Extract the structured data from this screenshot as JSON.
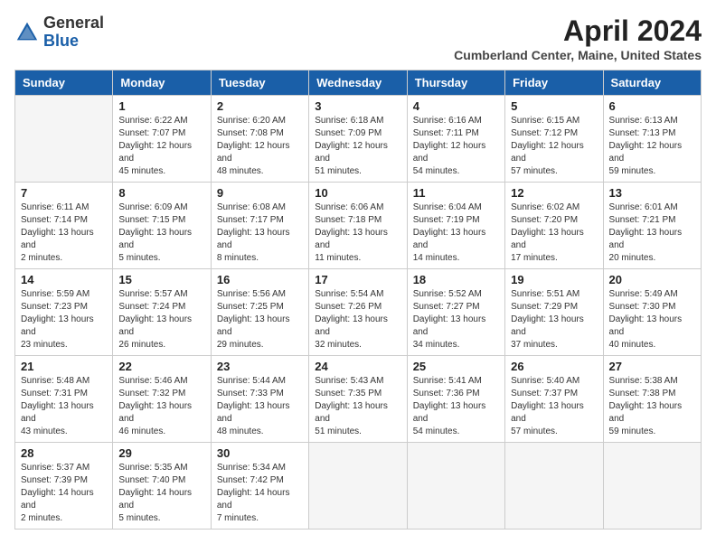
{
  "logo": {
    "general": "General",
    "blue": "Blue"
  },
  "header": {
    "month_year": "April 2024",
    "location": "Cumberland Center, Maine, United States"
  },
  "days_of_week": [
    "Sunday",
    "Monday",
    "Tuesday",
    "Wednesday",
    "Thursday",
    "Friday",
    "Saturday"
  ],
  "weeks": [
    [
      {
        "day": "",
        "empty": true
      },
      {
        "day": "1",
        "sunrise": "6:22 AM",
        "sunset": "7:07 PM",
        "daylight": "12 hours and 45 minutes."
      },
      {
        "day": "2",
        "sunrise": "6:20 AM",
        "sunset": "7:08 PM",
        "daylight": "12 hours and 48 minutes."
      },
      {
        "day": "3",
        "sunrise": "6:18 AM",
        "sunset": "7:09 PM",
        "daylight": "12 hours and 51 minutes."
      },
      {
        "day": "4",
        "sunrise": "6:16 AM",
        "sunset": "7:11 PM",
        "daylight": "12 hours and 54 minutes."
      },
      {
        "day": "5",
        "sunrise": "6:15 AM",
        "sunset": "7:12 PM",
        "daylight": "12 hours and 57 minutes."
      },
      {
        "day": "6",
        "sunrise": "6:13 AM",
        "sunset": "7:13 PM",
        "daylight": "12 hours and 59 minutes."
      }
    ],
    [
      {
        "day": "7",
        "sunrise": "6:11 AM",
        "sunset": "7:14 PM",
        "daylight": "13 hours and 2 minutes."
      },
      {
        "day": "8",
        "sunrise": "6:09 AM",
        "sunset": "7:15 PM",
        "daylight": "13 hours and 5 minutes."
      },
      {
        "day": "9",
        "sunrise": "6:08 AM",
        "sunset": "7:17 PM",
        "daylight": "13 hours and 8 minutes."
      },
      {
        "day": "10",
        "sunrise": "6:06 AM",
        "sunset": "7:18 PM",
        "daylight": "13 hours and 11 minutes."
      },
      {
        "day": "11",
        "sunrise": "6:04 AM",
        "sunset": "7:19 PM",
        "daylight": "13 hours and 14 minutes."
      },
      {
        "day": "12",
        "sunrise": "6:02 AM",
        "sunset": "7:20 PM",
        "daylight": "13 hours and 17 minutes."
      },
      {
        "day": "13",
        "sunrise": "6:01 AM",
        "sunset": "7:21 PM",
        "daylight": "13 hours and 20 minutes."
      }
    ],
    [
      {
        "day": "14",
        "sunrise": "5:59 AM",
        "sunset": "7:23 PM",
        "daylight": "13 hours and 23 minutes."
      },
      {
        "day": "15",
        "sunrise": "5:57 AM",
        "sunset": "7:24 PM",
        "daylight": "13 hours and 26 minutes."
      },
      {
        "day": "16",
        "sunrise": "5:56 AM",
        "sunset": "7:25 PM",
        "daylight": "13 hours and 29 minutes."
      },
      {
        "day": "17",
        "sunrise": "5:54 AM",
        "sunset": "7:26 PM",
        "daylight": "13 hours and 32 minutes."
      },
      {
        "day": "18",
        "sunrise": "5:52 AM",
        "sunset": "7:27 PM",
        "daylight": "13 hours and 34 minutes."
      },
      {
        "day": "19",
        "sunrise": "5:51 AM",
        "sunset": "7:29 PM",
        "daylight": "13 hours and 37 minutes."
      },
      {
        "day": "20",
        "sunrise": "5:49 AM",
        "sunset": "7:30 PM",
        "daylight": "13 hours and 40 minutes."
      }
    ],
    [
      {
        "day": "21",
        "sunrise": "5:48 AM",
        "sunset": "7:31 PM",
        "daylight": "13 hours and 43 minutes."
      },
      {
        "day": "22",
        "sunrise": "5:46 AM",
        "sunset": "7:32 PM",
        "daylight": "13 hours and 46 minutes."
      },
      {
        "day": "23",
        "sunrise": "5:44 AM",
        "sunset": "7:33 PM",
        "daylight": "13 hours and 48 minutes."
      },
      {
        "day": "24",
        "sunrise": "5:43 AM",
        "sunset": "7:35 PM",
        "daylight": "13 hours and 51 minutes."
      },
      {
        "day": "25",
        "sunrise": "5:41 AM",
        "sunset": "7:36 PM",
        "daylight": "13 hours and 54 minutes."
      },
      {
        "day": "26",
        "sunrise": "5:40 AM",
        "sunset": "7:37 PM",
        "daylight": "13 hours and 57 minutes."
      },
      {
        "day": "27",
        "sunrise": "5:38 AM",
        "sunset": "7:38 PM",
        "daylight": "13 hours and 59 minutes."
      }
    ],
    [
      {
        "day": "28",
        "sunrise": "5:37 AM",
        "sunset": "7:39 PM",
        "daylight": "14 hours and 2 minutes."
      },
      {
        "day": "29",
        "sunrise": "5:35 AM",
        "sunset": "7:40 PM",
        "daylight": "14 hours and 5 minutes."
      },
      {
        "day": "30",
        "sunrise": "5:34 AM",
        "sunset": "7:42 PM",
        "daylight": "14 hours and 7 minutes."
      },
      {
        "day": "",
        "empty": true
      },
      {
        "day": "",
        "empty": true
      },
      {
        "day": "",
        "empty": true
      },
      {
        "day": "",
        "empty": true
      }
    ]
  ]
}
